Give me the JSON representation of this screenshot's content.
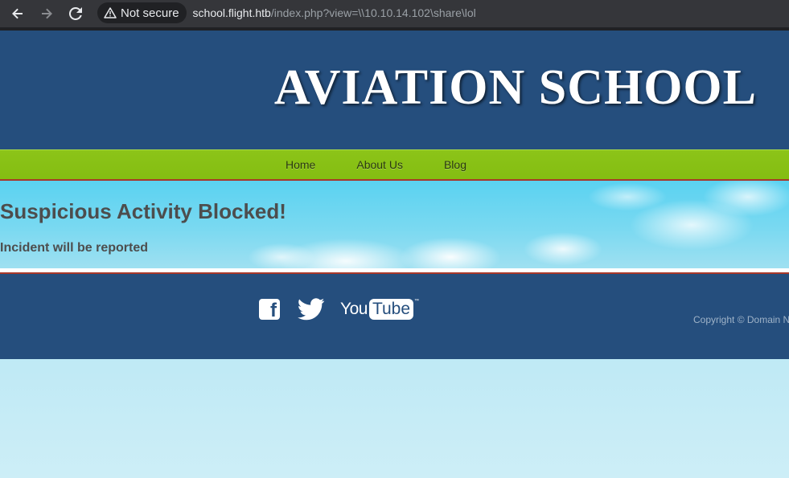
{
  "browser": {
    "security_label": "Not secure",
    "url_host": "school.flight.htb",
    "url_path": "/index.php?view=\\\\10.10.14.102\\share\\lol",
    "icons": [
      "back-arrow-icon",
      "forward-arrow-icon",
      "reload-icon",
      "warning-triangle-icon"
    ]
  },
  "header": {
    "logo_text": "AVIATION SCHOOL"
  },
  "nav": {
    "items": [
      {
        "label": "Home"
      },
      {
        "label": "About Us"
      },
      {
        "label": "Blog"
      }
    ]
  },
  "main": {
    "heading": "Suspicious Activity Blocked!",
    "message": "Incident will be reported"
  },
  "footer": {
    "social": {
      "icons": [
        "facebook-icon",
        "twitter-icon",
        "youtube-logo"
      ],
      "youtube_you": "You",
      "youtube_tube": "Tube",
      "youtube_tm": "™"
    },
    "copyright": "Copyright © Domain N"
  },
  "colors": {
    "header_bg": "#254e7d",
    "nav_bg": "#84bd12",
    "accent_line": "#a8382a",
    "heading_text": "#4d4d4d"
  }
}
